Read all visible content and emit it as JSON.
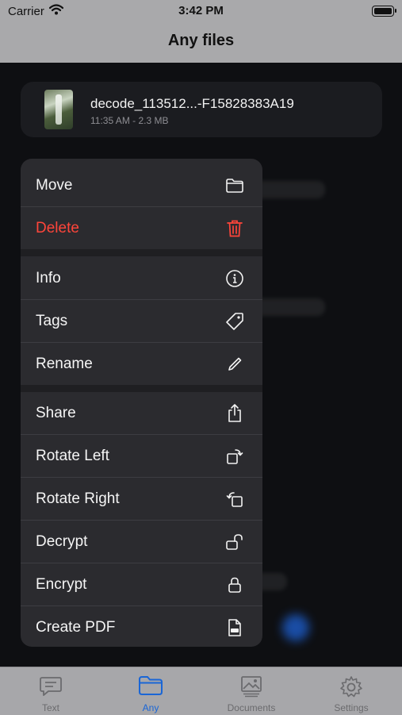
{
  "status_bar": {
    "carrier": "Carrier",
    "time": "3:42 PM"
  },
  "nav": {
    "title": "Any files"
  },
  "file": {
    "name": "decode_113512...-F15828383A19",
    "meta": "11:35 AM - 2.3 MB"
  },
  "menu": {
    "move": "Move",
    "delete": "Delete",
    "info": "Info",
    "tags": "Tags",
    "rename": "Rename",
    "share": "Share",
    "rotate_left": "Rotate Left",
    "rotate_right": "Rotate Right",
    "decrypt": "Decrypt",
    "encrypt": "Encrypt",
    "create_pdf": "Create PDF"
  },
  "tabs": [
    {
      "label": "Text",
      "icon": "text-bubble-icon"
    },
    {
      "label": "Any",
      "icon": "folder-icon",
      "active": true
    },
    {
      "label": "Documents",
      "icon": "photo-stack-icon"
    },
    {
      "label": "Settings",
      "icon": "gear-icon"
    }
  ],
  "colors": {
    "accent": "#1a66d6",
    "danger": "#ff453a",
    "menu_bg": "#2b2b2f"
  }
}
